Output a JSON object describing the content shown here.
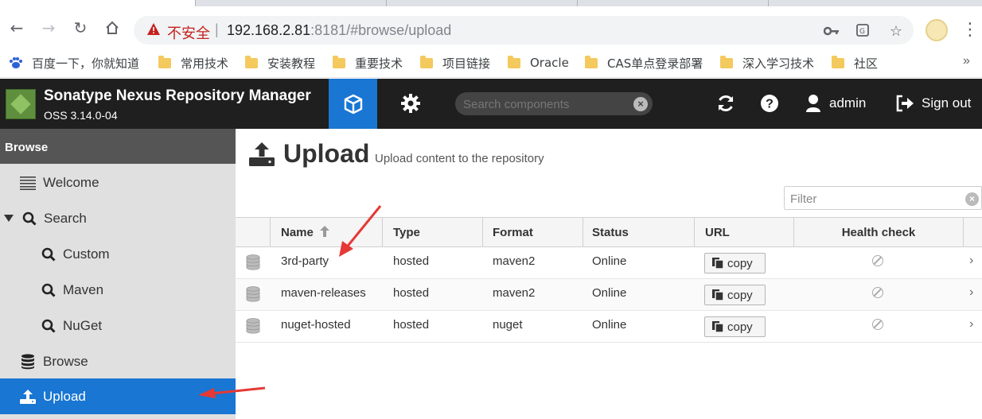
{
  "browser": {
    "insecure_label": "不安全",
    "url_host": "192.168.2.81",
    "url_rest": ":8181/#browse/upload",
    "bookmarks": [
      {
        "label": "百度一下，你就知道",
        "icon": "paw-icon"
      },
      {
        "label": "常用技术",
        "icon": "folder-icon"
      },
      {
        "label": "安装教程",
        "icon": "folder-icon"
      },
      {
        "label": "重要技术",
        "icon": "folder-icon"
      },
      {
        "label": "项目链接",
        "icon": "folder-icon"
      },
      {
        "label": "Oracle",
        "icon": "folder-icon"
      },
      {
        "label": "CAS单点登录部署",
        "icon": "folder-icon"
      },
      {
        "label": "深入学习技术",
        "icon": "folder-icon"
      },
      {
        "label": "社区",
        "icon": "folder-icon"
      }
    ],
    "bookmarks_more": "»"
  },
  "header": {
    "title": "Sonatype Nexus Repository Manager",
    "version": "OSS 3.14.0-04",
    "search_placeholder": "Search components",
    "user": "admin",
    "sign_out": "Sign out",
    "accent": "#1976d2"
  },
  "sidebar": {
    "heading": "Browse",
    "items": [
      {
        "label": "Welcome",
        "icon": "list-icon"
      },
      {
        "label": "Search",
        "icon": "search-icon",
        "expanded": true
      },
      {
        "label": "Custom",
        "icon": "search-icon"
      },
      {
        "label": "Maven",
        "icon": "search-icon"
      },
      {
        "label": "NuGet",
        "icon": "search-icon"
      },
      {
        "label": "Browse",
        "icon": "database-icon"
      },
      {
        "label": "Upload",
        "icon": "upload-icon",
        "active": true
      }
    ]
  },
  "main": {
    "title": "Upload",
    "subtitle": "Upload content to the repository",
    "filter_placeholder": "Filter",
    "columns": [
      "Name",
      "Type",
      "Format",
      "Status",
      "URL",
      "Health check"
    ],
    "rows": [
      {
        "name": "3rd-party",
        "type": "hosted",
        "format": "maven2",
        "status": "Online",
        "url_button": "copy"
      },
      {
        "name": "maven-releases",
        "type": "hosted",
        "format": "maven2",
        "status": "Online",
        "url_button": "copy"
      },
      {
        "name": "nuget-hosted",
        "type": "hosted",
        "format": "nuget",
        "status": "Online",
        "url_button": "copy"
      }
    ]
  }
}
